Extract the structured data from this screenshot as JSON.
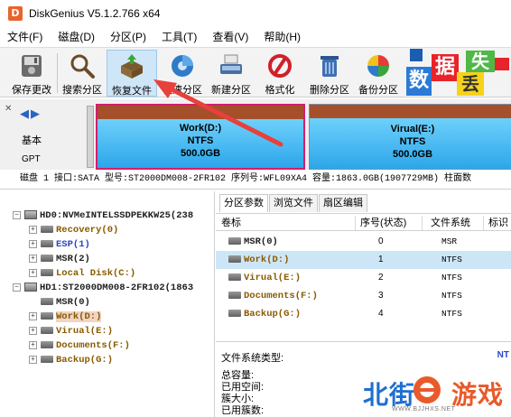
{
  "window": {
    "title": "DiskGenius V5.1.2.766 x64",
    "app_icon_glyph": "D"
  },
  "menu": [
    {
      "label": "文件(F)"
    },
    {
      "label": "磁盘(D)"
    },
    {
      "label": "分区(P)"
    },
    {
      "label": "工具(T)"
    },
    {
      "label": "查看(V)"
    },
    {
      "label": "帮助(H)"
    }
  ],
  "toolbar": {
    "buttons": [
      {
        "label": "保存更改",
        "icon": "save-disk-icon"
      },
      {
        "label": "搜索分区",
        "icon": "magnifier-icon"
      },
      {
        "label": "恢复文件",
        "icon": "recover-box-icon"
      },
      {
        "label": "快速分区",
        "icon": "quick-partition-icon"
      },
      {
        "label": "新建分区",
        "icon": "new-partition-icon"
      },
      {
        "label": "格式化",
        "icon": "format-icon"
      },
      {
        "label": "删除分区",
        "icon": "trash-icon"
      },
      {
        "label": "备份分区",
        "icon": "backup-icon"
      }
    ],
    "ad_tiles": [
      "数",
      "据",
      "丢",
      "失"
    ]
  },
  "diskmap": {
    "basic_label": "基本",
    "gpt_label": "GPT",
    "partitions": [
      {
        "name": "Work(D:)",
        "fs": "NTFS",
        "size": "500.0GB",
        "selected": true
      },
      {
        "name": "Virual(E:)",
        "fs": "NTFS",
        "size": "500.0GB",
        "selected": false
      }
    ]
  },
  "disk_info": "磁盘 1 接口:SATA  型号:ST2000DM008-2FR102  序列号:WFL09XA4  容量:1863.0GB(1907729MB)  柱面数",
  "tree": {
    "disks": [
      {
        "label": "HD0:NVMeINTELSSDPEKKW25(238",
        "partitions": [
          {
            "label": "Recovery(0)",
            "color": "brown",
            "expandable": true
          },
          {
            "label": "ESP(1)",
            "color": "blue",
            "expandable": true
          },
          {
            "label": "MSR(2)",
            "color": "black",
            "expandable": true
          },
          {
            "label": "Local Disk(C:)",
            "color": "brown",
            "expandable": true
          }
        ]
      },
      {
        "label": "HD1:ST2000DM008-2FR102(1863",
        "partitions": [
          {
            "label": "MSR(0)",
            "color": "black",
            "expandable": false
          },
          {
            "label": "Work(D:)",
            "color": "brown",
            "expandable": true,
            "selected": true
          },
          {
            "label": "Virual(E:)",
            "color": "brown",
            "expandable": true
          },
          {
            "label": "Documents(F:)",
            "color": "brown",
            "expandable": true
          },
          {
            "label": "Backup(G:)",
            "color": "brown",
            "expandable": true
          }
        ]
      }
    ]
  },
  "right": {
    "tabs": [
      "分区参数",
      "浏览文件",
      "扇区编辑"
    ],
    "columns": [
      "卷标",
      "序号(状态)",
      "文件系统",
      "标识"
    ],
    "rows": [
      {
        "name": "MSR(0)",
        "num": "0",
        "fs": "MSR",
        "color": "black",
        "selected": false
      },
      {
        "name": "Work(D:)",
        "num": "1",
        "fs": "NTFS",
        "color": "brown",
        "selected": true
      },
      {
        "name": "Virual(E:)",
        "num": "2",
        "fs": "NTFS",
        "color": "brown",
        "selected": false
      },
      {
        "name": "Documents(F:)",
        "num": "3",
        "fs": "NTFS",
        "color": "brown",
        "selected": false
      },
      {
        "name": "Backup(G:)",
        "num": "4",
        "fs": "NTFS",
        "color": "brown",
        "selected": false
      }
    ],
    "fs_type_label": "文件系统类型:",
    "fs_type_value": "NT",
    "details": [
      "总容量:",
      "已用空间:",
      "簇大小:",
      "已用簇数:"
    ]
  },
  "watermark": {
    "text": "北街游戏",
    "url": "WWW.BJJHXS.NET"
  },
  "colors": {
    "selected_border": "#d21e6e",
    "partition_blue": "#46b8f0",
    "partition_band": "#a5502a",
    "arrow": "#e8403a"
  }
}
